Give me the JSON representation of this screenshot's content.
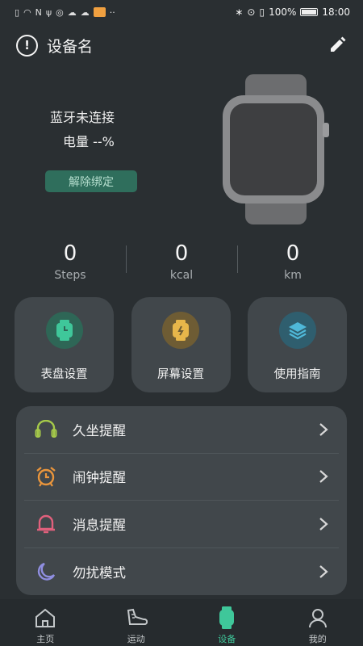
{
  "status_bar": {
    "battery_percent": "100%",
    "time": "18:00"
  },
  "header": {
    "device_name": "设备名",
    "info_icon": "info-icon",
    "edit_icon": "pencil-icon"
  },
  "device": {
    "bt_status": "蓝牙未连接",
    "battery_line": "电量 --%",
    "unbind_label": "解除绑定"
  },
  "stats": [
    {
      "value": "0",
      "label": "Steps"
    },
    {
      "value": "0",
      "label": "kcal"
    },
    {
      "value": "0",
      "label": "km"
    }
  ],
  "tiles": [
    {
      "label": "表盘设置",
      "icon": "watch-face-icon",
      "color": "#3fc79a"
    },
    {
      "label": "屏幕设置",
      "icon": "screen-icon",
      "color": "#e7b64a"
    },
    {
      "label": "使用指南",
      "icon": "layers-icon",
      "color": "#4fb8d8"
    }
  ],
  "reminders": [
    {
      "label": "久坐提醒",
      "icon": "seat-icon",
      "color": "#a5c94a"
    },
    {
      "label": "闹钟提醒",
      "icon": "alarm-clock-icon",
      "color": "#e9953c"
    },
    {
      "label": "消息提醒",
      "icon": "bell-icon",
      "color": "#e0607c"
    },
    {
      "label": "勿扰模式",
      "icon": "moon-icon",
      "color": "#8f8ee0"
    }
  ],
  "nav": [
    {
      "label": "主页",
      "icon": "home-icon"
    },
    {
      "label": "运动",
      "icon": "shoe-icon"
    },
    {
      "label": "设备",
      "icon": "watch-icon",
      "active": true
    },
    {
      "label": "我的",
      "icon": "user-icon"
    }
  ],
  "colors": {
    "background": "#2a2f32",
    "card": "#41474b",
    "accent": "#3fc79a",
    "unbind_bg": "#2f6e5c"
  }
}
